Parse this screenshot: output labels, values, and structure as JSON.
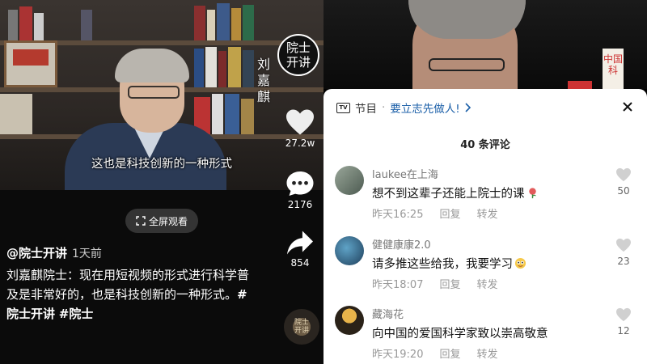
{
  "left": {
    "subtitle": "这也是科技创新的一种形式",
    "channel_badge": "院士开讲",
    "vertical_name": "刘嘉麒",
    "fullscreen_label": "全屏观看",
    "author": "@院士开讲",
    "posted": "1天前",
    "caption_text": "刘嘉麒院士：现在用短视频的形式进行科学普及是非常好的，也是科技创新的一种形式。",
    "hashtags": [
      "#院士开讲",
      "#院士"
    ],
    "likes": "27.2w",
    "comments": "2176",
    "shares": "854",
    "music_disc_text": "院士开讲"
  },
  "right": {
    "bg_sign": "中国科",
    "program_label": "节目",
    "separator": "·",
    "program_title": "要立志先做人!",
    "comment_count": "40 条评论",
    "comments": [
      {
        "user": "laukee在上海",
        "text": "想不到这辈子还能上院士的课",
        "time": "昨天16:25",
        "reply": "回复",
        "share": "转发",
        "likes": "50"
      },
      {
        "user": "健健康康2.0",
        "text": "请多推这些给我，我要学习",
        "time": "昨天18:07",
        "reply": "回复",
        "share": "转发",
        "likes": "23"
      },
      {
        "user": "藏海花",
        "text": "向中国的爱国科学家致以崇高敬意",
        "time": "昨天19:20",
        "reply": "回复",
        "share": "转发",
        "likes": "12"
      }
    ]
  },
  "colors": {
    "link": "#1b5fa8",
    "sheet_bg": "#ffffff"
  }
}
